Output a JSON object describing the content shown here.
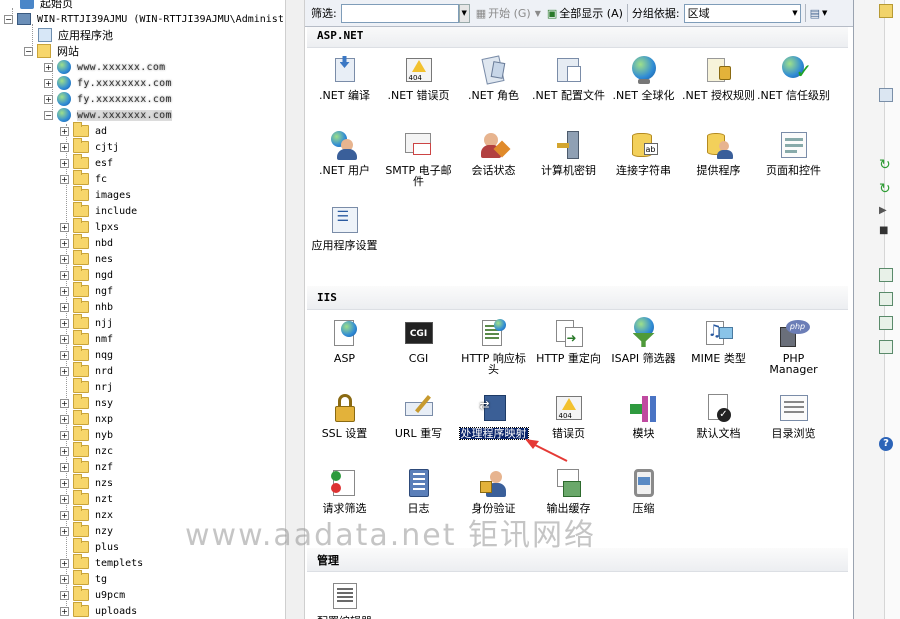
{
  "tree": {
    "start_page": "起始页",
    "server": "WIN-RTTJI39AJMU (WIN-RTTJI39AJMU\\Administ",
    "app_pools": "应用程序池",
    "sites": "网站",
    "hosts": [
      "www.xxxxxx.com",
      "fy.xxxxxxxx.com",
      "fy.xxxxxxxx.com",
      "www.xxxxxxx.com"
    ],
    "folders": [
      "ad",
      "cjtj",
      "esf",
      "fc",
      "images",
      "include",
      "lpxs",
      "nbd",
      "nes",
      "ngd",
      "ngf",
      "nhb",
      "njj",
      "nmf",
      "nqg",
      "nrd",
      "nrj",
      "nsy",
      "nxp",
      "nyb",
      "nzc",
      "nzf",
      "nzs",
      "nzt",
      "nzx",
      "nzy",
      "plus",
      "templets",
      "tg",
      "u9pcm",
      "uploads"
    ]
  },
  "toolbar": {
    "filter_label": "筛选:",
    "start_label": "开始 (G)",
    "show_all_label": "全部显示 (A)",
    "group_by_label": "分组依据:",
    "group_value": "区域"
  },
  "sections": {
    "aspnet": "ASP.NET",
    "iis": "IIS",
    "management": "管理"
  },
  "aspnet_items": [
    {
      "label": ".NET 编译",
      "icon": "dotnet-compile-icon"
    },
    {
      "label": ".NET 错误页",
      "icon": "warning-page-icon"
    },
    {
      "label": ".NET 角色",
      "icon": "roles-icon"
    },
    {
      "label": ".NET 配置文件",
      "icon": "profile-icon"
    },
    {
      "label": ".NET 全球化",
      "icon": "globe-icon"
    },
    {
      "label": ".NET 授权规则",
      "icon": "auth-rules-icon"
    },
    {
      "label": ".NET 信任级别",
      "icon": "trust-level-icon"
    },
    {
      "label": ".NET 用户",
      "icon": "users-icon"
    },
    {
      "label": "SMTP 电子邮件",
      "icon": "smtp-mail-icon"
    },
    {
      "label": "会话状态",
      "icon": "session-state-icon"
    },
    {
      "label": "计算机密钥",
      "icon": "machine-key-icon"
    },
    {
      "label": "连接字符串",
      "icon": "connection-string-icon"
    },
    {
      "label": "提供程序",
      "icon": "providers-icon"
    },
    {
      "label": "页面和控件",
      "icon": "pages-controls-icon"
    },
    {
      "label": "应用程序设置",
      "icon": "app-settings-icon"
    }
  ],
  "iis_items": [
    {
      "label": "ASP",
      "icon": "asp-icon"
    },
    {
      "label": "CGI",
      "icon": "cgi-icon"
    },
    {
      "label": "HTTP 响应标头",
      "icon": "http-headers-icon"
    },
    {
      "label": "HTTP 重定向",
      "icon": "http-redirect-icon"
    },
    {
      "label": "ISAPI 筛选器",
      "icon": "isapi-filter-icon"
    },
    {
      "label": "MIME 类型",
      "icon": "mime-type-icon"
    },
    {
      "label": "PHP Manager",
      "icon": "php-manager-icon"
    },
    {
      "label": "SSL 设置",
      "icon": "ssl-lock-icon"
    },
    {
      "label": "URL 重写",
      "icon": "url-rewrite-icon"
    },
    {
      "label": "处理程序映射",
      "icon": "handler-mapping-icon"
    },
    {
      "label": "错误页",
      "icon": "error-page-icon"
    },
    {
      "label": "模块",
      "icon": "modules-icon"
    },
    {
      "label": "默认文档",
      "icon": "default-document-icon"
    },
    {
      "label": "目录浏览",
      "icon": "directory-browsing-icon"
    },
    {
      "label": "请求筛选",
      "icon": "request-filtering-icon"
    },
    {
      "label": "日志",
      "icon": "logging-icon"
    },
    {
      "label": "身份验证",
      "icon": "authentication-icon"
    },
    {
      "label": "输出缓存",
      "icon": "output-cache-icon"
    },
    {
      "label": "压缩",
      "icon": "compression-icon"
    }
  ],
  "management_items": [
    {
      "label": "配置编辑器",
      "icon": "config-editor-icon"
    }
  ],
  "watermark": "www.aadata.net  钜讯网络",
  "colors": {
    "selection": "#0a246a",
    "arrow": "#e53935"
  }
}
